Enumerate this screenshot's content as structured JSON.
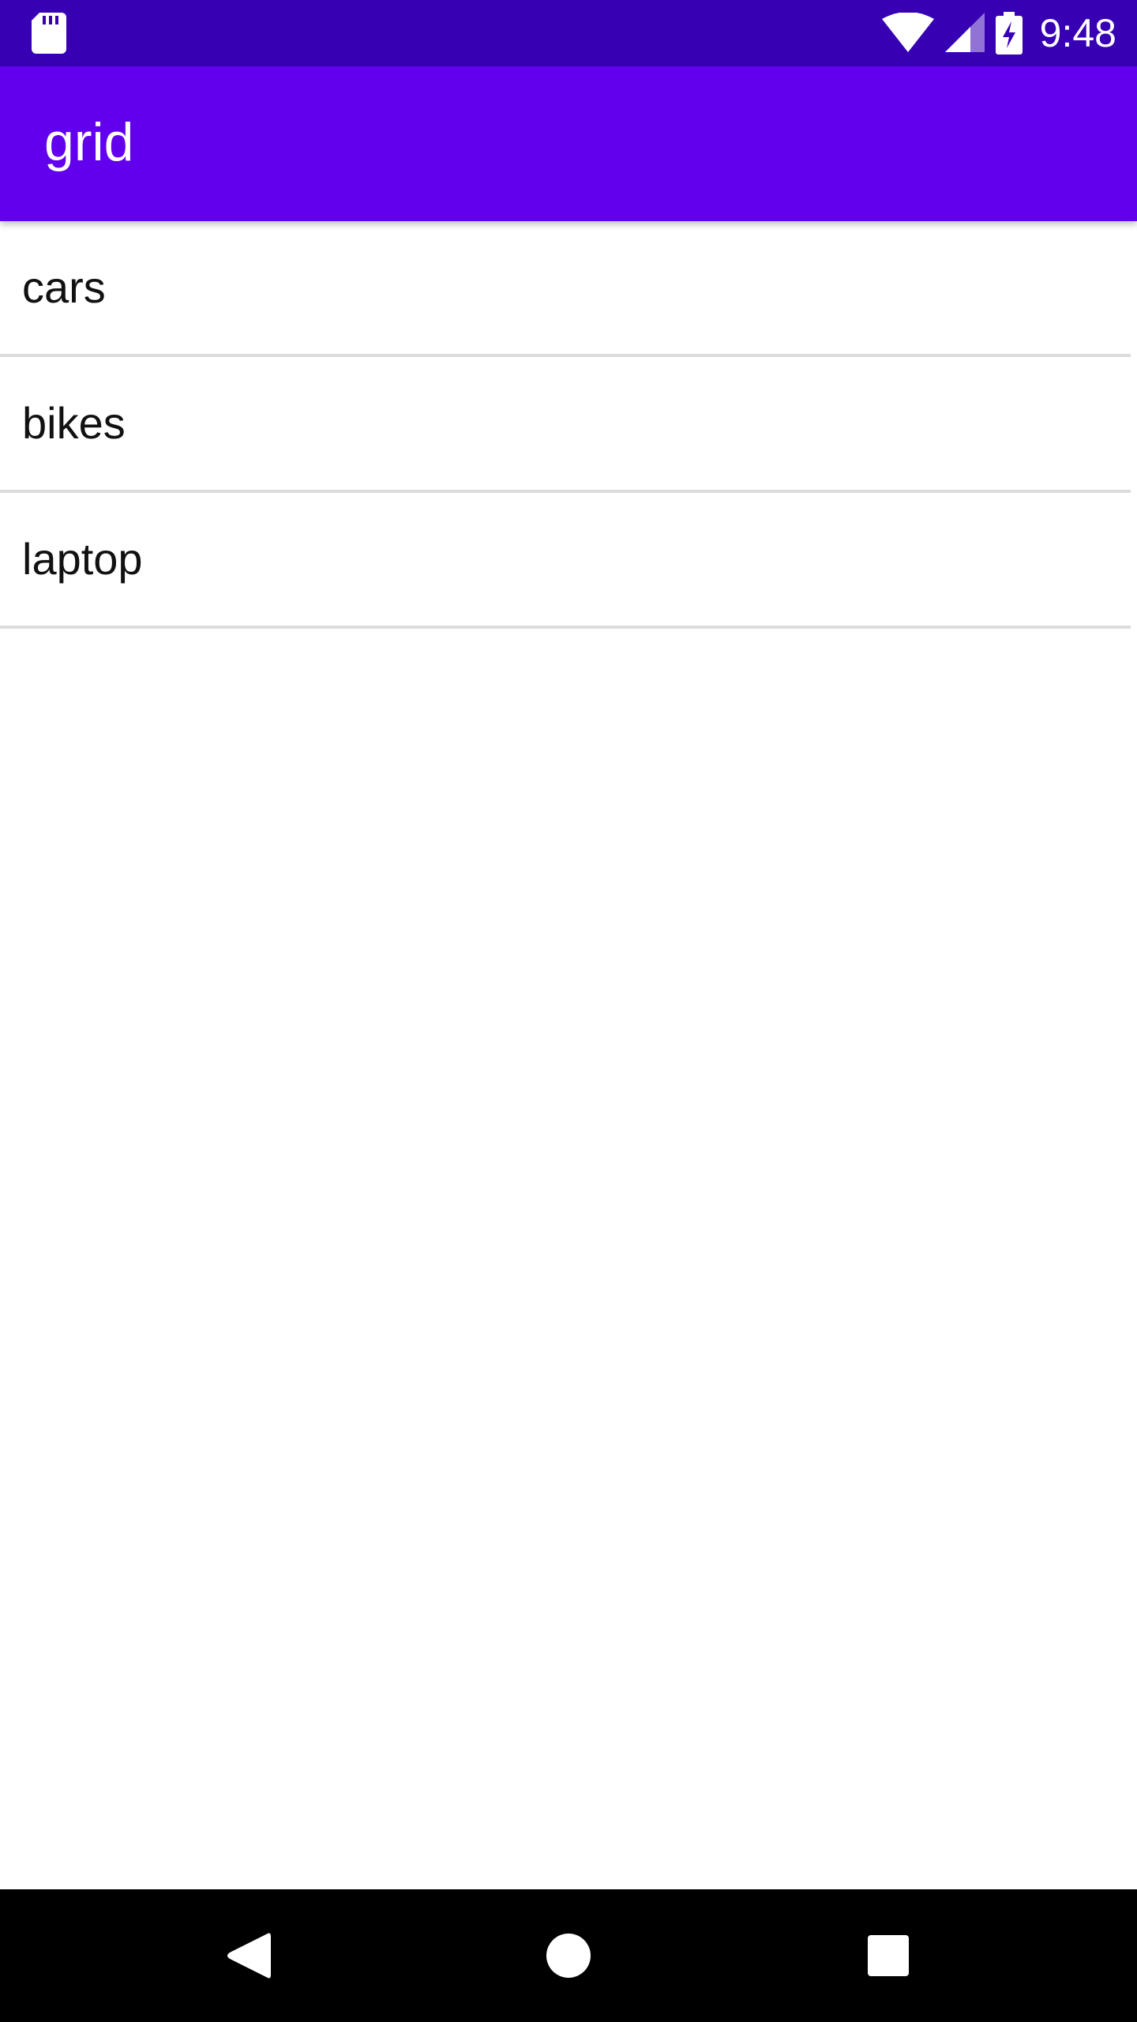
{
  "status_bar": {
    "time": "9:48",
    "icons": [
      "sd-card-icon",
      "wifi-icon",
      "cell-signal-icon",
      "battery-charging-icon"
    ],
    "background": "#3700b3"
  },
  "app_bar": {
    "title": "grid",
    "background": "#6200ee"
  },
  "list": {
    "items": [
      {
        "label": "cars"
      },
      {
        "label": "bikes"
      },
      {
        "label": "laptop"
      }
    ]
  },
  "nav_bar": {
    "buttons": [
      "back-icon",
      "home-icon",
      "recents-icon"
    ]
  }
}
